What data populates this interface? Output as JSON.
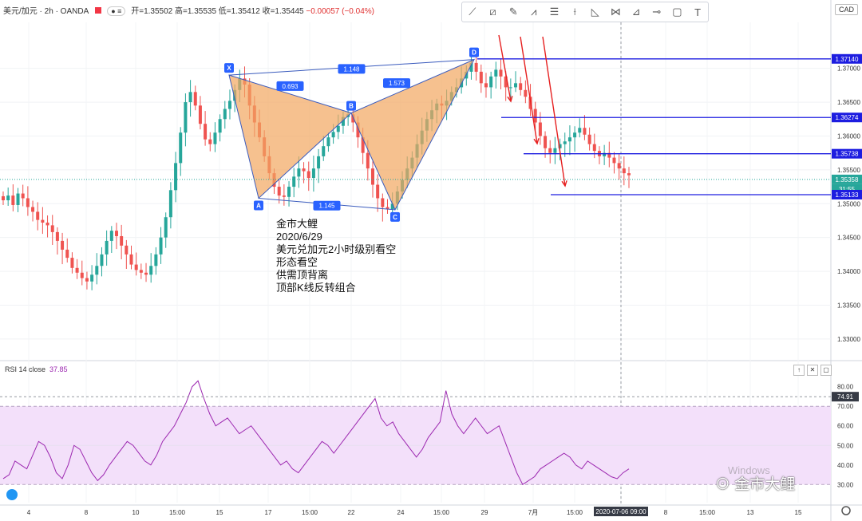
{
  "header": {
    "symbol": "美元/加元 · 2h · OANDA",
    "open": "开=1.35502",
    "high": "高=1.35535",
    "low": "低=1.35412",
    "close": "收=1.35445",
    "change": "−0.00057 (−0.04%)"
  },
  "currency_label": "CAD",
  "toolbar": {
    "icons": [
      "trend-line-icon",
      "channel-icon",
      "brush-icon",
      "pattern-icon",
      "long-position-icon",
      "vertical-line-icon",
      "fib-icon",
      "xabcd-icon",
      "path-icon",
      "horizontal-ray-icon",
      "rectangle-icon",
      "text-icon"
    ]
  },
  "note": {
    "line1": "金市大鲤",
    "line2": "2020/6/29",
    "line3": "美元兑加元2小时级别看空",
    "line4": "形态看空",
    "line5": "供需顶背离",
    "line6": "顶部K线反转组合"
  },
  "rsi": {
    "title": "RSI 14 close",
    "value": "37.85",
    "marker": "74.91",
    "buttons": [
      "↑",
      "✕",
      "▢"
    ]
  },
  "watermark": {
    "text": "金市大鲤",
    "faint": "Windows"
  },
  "colors": {
    "up": "#26a69a",
    "down": "#ef5350",
    "pattern_fill": "#f2a660",
    "level": "#1d1de0",
    "arrow": "#e62020",
    "rsi_line": "#9c27b0",
    "rsi_band": "#f3e0fa"
  },
  "chart_data": [
    {
      "type": "candlestick",
      "title": "美元/加元 · 2h · OANDA",
      "ylim": [
        1.3268,
        1.3768
      ],
      "y_ticks": [
        "1.37000",
        "1.36500",
        "1.36000",
        "1.35500",
        "1.35000",
        "1.34500",
        "1.34000",
        "1.33500",
        "1.33000"
      ],
      "x_ticks": [
        "4",
        "8",
        "10",
        "15:00",
        "15",
        "17",
        "15:00",
        "22",
        "24",
        "15:00",
        "29",
        "7月",
        "15:00",
        "2020-07-06  09:00",
        "8",
        "15:00",
        "13",
        "15"
      ],
      "price_labels": [
        "1.37140",
        "1.36274",
        "1.35738",
        "1.35358",
        "31:55",
        "1.35133"
      ],
      "pattern": {
        "points": [
          {
            "name": "X",
            "price": 1.369
          },
          {
            "name": "A",
            "price": 1.3508
          },
          {
            "name": "B",
            "price": 1.3634
          },
          {
            "name": "C",
            "price": 1.3491
          },
          {
            "name": "D",
            "price": 1.3713
          }
        ],
        "ratios": [
          "0.693",
          "1.148",
          "1.573",
          "1.145"
        ]
      },
      "levels": [
        1.3714,
        1.36274,
        1.35738,
        1.35133
      ],
      "current_price": 1.35358,
      "close_series": [
        1.3505,
        1.3512,
        1.3498,
        1.3515,
        1.3508,
        1.3495,
        1.3488,
        1.3476,
        1.3472,
        1.3468,
        1.3458,
        1.3445,
        1.3432,
        1.342,
        1.3405,
        1.3398,
        1.339,
        1.3385,
        1.3395,
        1.3408,
        1.3425,
        1.3445,
        1.346,
        1.3452,
        1.3438,
        1.3425,
        1.341,
        1.3402,
        1.3398,
        1.3395,
        1.3408,
        1.3425,
        1.345,
        1.348,
        1.352,
        1.356,
        1.3605,
        1.365,
        1.3665,
        1.3645,
        1.3618,
        1.3595,
        1.3588,
        1.3605,
        1.3625,
        1.364,
        1.3652,
        1.3668,
        1.3685,
        1.3676,
        1.3645,
        1.362,
        1.3598,
        1.357,
        1.3545,
        1.3525,
        1.3512,
        1.351,
        1.3525,
        1.354,
        1.3552,
        1.3548,
        1.3538,
        1.3552,
        1.357,
        1.3585,
        1.3598,
        1.3606,
        1.3615,
        1.3628,
        1.3632,
        1.362,
        1.3598,
        1.3575,
        1.3552,
        1.3528,
        1.3508,
        1.3495,
        1.3492,
        1.35,
        1.3518,
        1.3535,
        1.3552,
        1.3568,
        1.3588,
        1.3608,
        1.3625,
        1.3638,
        1.3648,
        1.3645,
        1.3652,
        1.3665,
        1.3672,
        1.3685,
        1.3695,
        1.3708,
        1.3695,
        1.3678,
        1.3672,
        1.3688,
        1.3698,
        1.3688,
        1.3672,
        1.3672,
        1.3678,
        1.3668,
        1.3658,
        1.364,
        1.362,
        1.36,
        1.3582,
        1.3575,
        1.3582,
        1.3588,
        1.3592,
        1.3598,
        1.3605,
        1.3612,
        1.3602,
        1.3588,
        1.3578,
        1.357,
        1.3575,
        1.3568,
        1.356,
        1.3552,
        1.3545,
        1.3542
      ],
      "rsi_series": [
        33,
        35,
        42,
        40,
        38,
        45,
        52,
        50,
        44,
        36,
        33,
        40,
        50,
        48,
        42,
        36,
        32,
        35,
        40,
        44,
        48,
        52,
        50,
        46,
        42,
        40,
        45,
        52,
        56,
        60,
        66,
        72,
        80,
        83,
        74,
        66,
        60,
        62,
        64,
        60,
        56,
        58,
        60,
        56,
        52,
        48,
        44,
        40,
        42,
        38,
        36,
        40,
        44,
        48,
        52,
        50,
        46,
        50,
        54,
        58,
        62,
        66,
        70,
        74,
        64,
        60,
        62,
        56,
        52,
        48,
        44,
        48,
        54,
        58,
        62,
        78,
        66,
        60,
        56,
        60,
        64,
        60,
        56,
        58,
        60,
        52,
        44,
        36,
        30,
        32,
        34,
        38,
        40,
        42,
        44,
        46,
        44,
        40,
        38,
        42,
        40,
        38,
        36,
        34,
        33,
        36,
        38
      ],
      "rsi_ylim": [
        24,
        86
      ],
      "rsi_ticks": [
        "80.00",
        "70.00",
        "60.00",
        "50.00",
        "40.00",
        "30.00"
      ]
    }
  ]
}
